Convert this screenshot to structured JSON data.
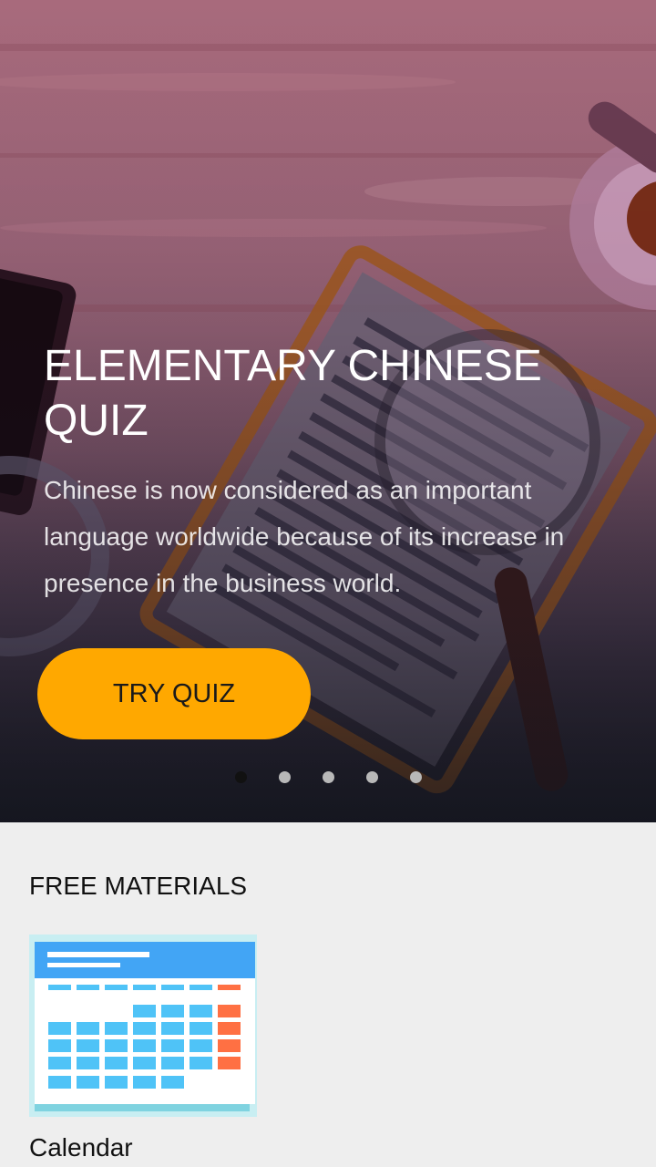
{
  "hero": {
    "title": "ELEMENTARY CHINESE QUIZ",
    "description": "Chinese is now considered as an important language worldwide because of its increase in presence in the business world.",
    "cta_label": "TRY QUIZ",
    "carousel": {
      "count": 5,
      "active_index": 0
    }
  },
  "free_materials": {
    "title": "FREE MATERIALS",
    "items": [
      {
        "label": "Calendar",
        "icon": "calendar-icon"
      }
    ]
  },
  "colors": {
    "accent": "#ffa800",
    "background": "#eeeeee",
    "dot_active": "#111111",
    "dot_inactive": "#b8b8b8"
  }
}
